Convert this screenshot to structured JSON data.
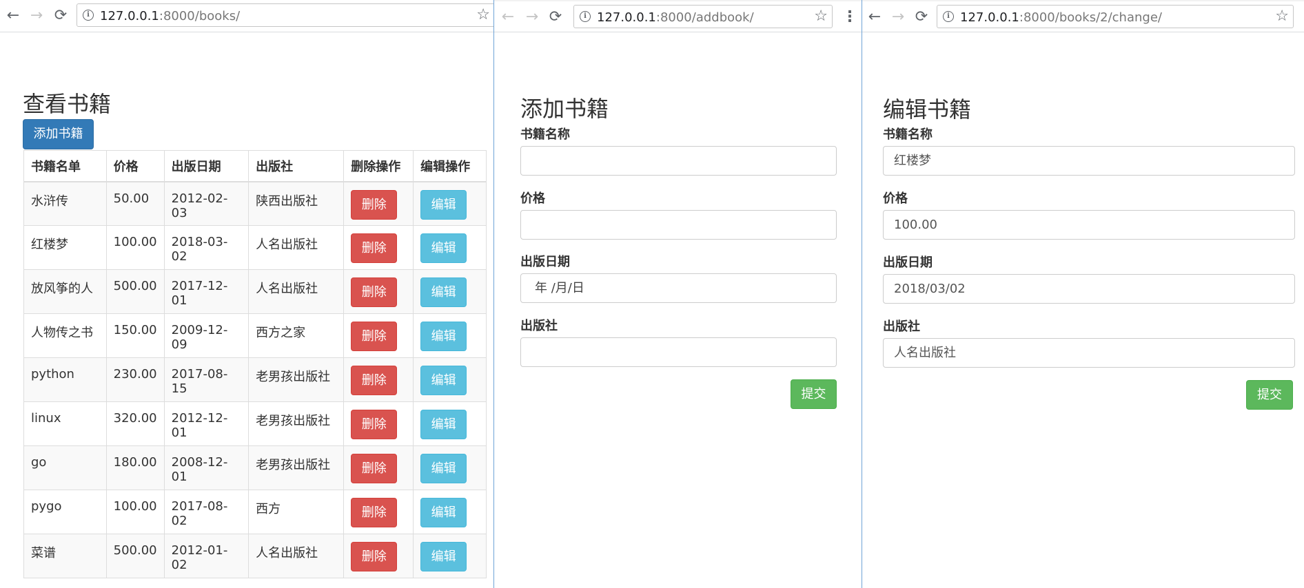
{
  "list_window": {
    "url_host": "127.0.0.1",
    "url_rest": ":8000/books/",
    "title": "查看书籍",
    "add_button": "添加书籍",
    "columns": [
      "书籍名单",
      "价格",
      "出版日期",
      "出版社",
      "删除操作",
      "编辑操作"
    ],
    "delete_label": "删除",
    "edit_label": "编辑",
    "rows": [
      [
        "水浒传",
        "50.00",
        "2012-02-03",
        "陕西出版社"
      ],
      [
        "红楼梦",
        "100.00",
        "2018-03-02",
        "人名出版社"
      ],
      [
        "放风筝的人",
        "500.00",
        "2017-12-01",
        "人名出版社"
      ],
      [
        "人物传之书",
        "150.00",
        "2009-12-09",
        "西方之家"
      ],
      [
        "python",
        "230.00",
        "2017-08-15",
        "老男孩出版社"
      ],
      [
        "linux",
        "320.00",
        "2012-12-01",
        "老男孩出版社"
      ],
      [
        "go",
        "180.00",
        "2008-12-01",
        "老男孩出版社"
      ],
      [
        "pygo",
        "100.00",
        "2017-08-02",
        "西方"
      ],
      [
        "菜谱",
        "500.00",
        "2012-01-02",
        "人名出版社"
      ]
    ]
  },
  "add_window": {
    "url_host": "127.0.0.1",
    "url_rest": ":8000/addbook/",
    "title": "添加书籍",
    "fields": [
      {
        "label": "书籍名称",
        "value": ""
      },
      {
        "label": "价格",
        "value": ""
      },
      {
        "label": "出版日期",
        "value": "年 /月/日"
      },
      {
        "label": "出版社",
        "value": ""
      }
    ],
    "submit": "提交"
  },
  "edit_window": {
    "url_host": "127.0.0.1",
    "url_rest": ":8000/books/2/change/",
    "title": "编辑书籍",
    "fields": [
      {
        "label": "书籍名称",
        "value": "红楼梦"
      },
      {
        "label": "价格",
        "value": "100.00"
      },
      {
        "label": "出版日期",
        "value": "2018/03/02"
      },
      {
        "label": "出版社",
        "value": "人名出版社"
      }
    ],
    "submit": "提交"
  },
  "icons": {
    "back": "←",
    "forward": "→",
    "reload": "⟳",
    "star": "☆",
    "info": "i",
    "menu": "⋮"
  }
}
